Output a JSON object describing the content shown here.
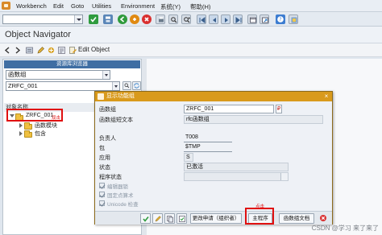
{
  "menubar": {
    "items": [
      "Workbench",
      "Edit",
      "Goto",
      "Utilities",
      "Environment",
      "系统(Y)",
      "帮助(H)"
    ]
  },
  "page": {
    "title": "Object Navigator"
  },
  "app_toolbar": {
    "edit_object_label": "Edit Object"
  },
  "left_pane": {
    "header": "资源库浏览器",
    "object_type": "函数组",
    "object_name": "ZRFC_001",
    "tree_header": "对象名称",
    "tree_items": [
      {
        "label": "ZRFC_001",
        "annotation": "双击"
      },
      {
        "label": "函数模块"
      },
      {
        "label": "包含"
      }
    ]
  },
  "dialog": {
    "title": "显示功能组",
    "fields": [
      {
        "label": "函数组",
        "value": "ZRFC_001"
      },
      {
        "label": "函数组短文本",
        "value": "rfc函数组"
      },
      {
        "label": "负责人",
        "value": "T008"
      },
      {
        "label": "包",
        "value": "$TMP"
      },
      {
        "label": "应用",
        "value": "S"
      },
      {
        "label": "状态",
        "value": "已激活"
      },
      {
        "label": "程序状态",
        "value": ""
      }
    ],
    "checkboxes": [
      {
        "label": "编辑器锁"
      },
      {
        "label": "固定点算术"
      },
      {
        "label": "Unicode 检查"
      }
    ],
    "buttons": {
      "change_request": "更改申请（组织者）",
      "main_program": "主程序",
      "fg_docs": "函数组文档",
      "main_program_annotation": "点击"
    }
  },
  "watermark": "CSDN @学习 来了来了",
  "colors": {
    "dialog_title": "#d99a1c",
    "highlight": "#e01010",
    "repo_header": "#3f6ea3"
  }
}
